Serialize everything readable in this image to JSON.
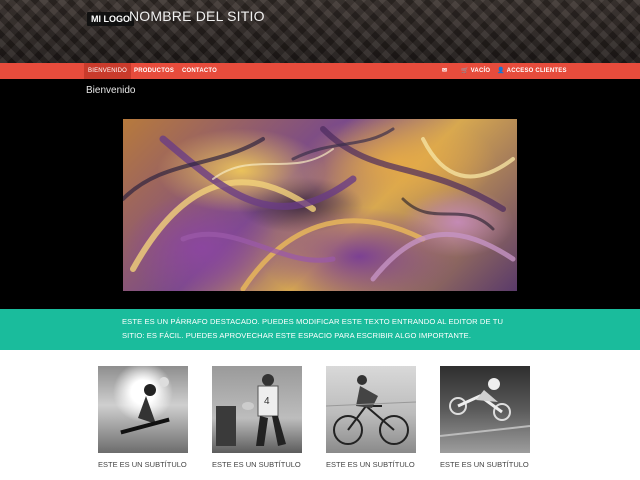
{
  "header": {
    "logo": "MI LOGO",
    "site_name": "NOMBRE DEL SITIO"
  },
  "nav": {
    "items": [
      {
        "label": "BIENVENIDO",
        "active": true
      },
      {
        "label": "PRODUCTOS",
        "active": false
      },
      {
        "label": "CONTACTO",
        "active": false
      }
    ],
    "right": [
      {
        "icon": "envelope-icon",
        "label": ""
      },
      {
        "icon": "cart-icon",
        "label": "VACÍO"
      },
      {
        "icon": "user-icon",
        "label": "ACCESO CLIENTES"
      }
    ]
  },
  "hero": {
    "welcome": "Bienvenido"
  },
  "band": {
    "text": "ESTE ES UN PÁRRAFO DESTACADO. PUEDES MODIFICAR ESTE TEXTO ENTRANDO AL EDITOR DE TU SITIO: ES FÁCIL. PUEDES APROVECHAR ESTE ESPACIO PARA ESCRIBIR ALGO IMPORTANTE."
  },
  "cards": [
    {
      "title": "ESTE ES UN SUBTÍTULO",
      "image": "snowboarder-photo"
    },
    {
      "title": "ESTE ES UN SUBTÍTULO",
      "image": "rugby-player-photo"
    },
    {
      "title": "ESTE ES UN SUBTÍTULO",
      "image": "cyclist-photo"
    },
    {
      "title": "ESTE ES UN SUBTÍTULO",
      "image": "motocross-photo"
    }
  ],
  "colors": {
    "nav": "#e74c3c",
    "nav_active": "#c93b2c",
    "band": "#1abc9c",
    "hero": "#000000"
  }
}
